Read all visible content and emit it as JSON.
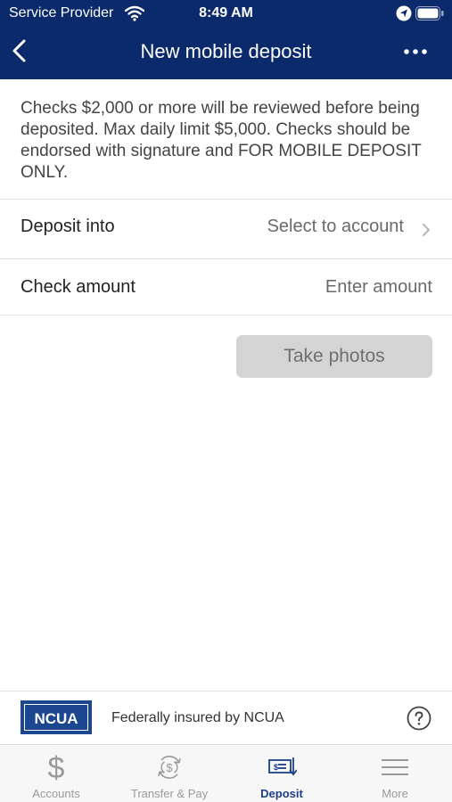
{
  "status_bar": {
    "carrier": "Service Provider",
    "time": "8:49 AM"
  },
  "nav": {
    "title": "New mobile deposit",
    "back_icon": "chevron-left-icon",
    "more_icon": "ellipsis-icon"
  },
  "notice": "Checks $2,000 or more will be reviewed before being deposited. Max daily limit $5,000. Checks should be endorsed with signature and FOR MOBILE DEPOSIT ONLY.",
  "form": {
    "deposit_into": {
      "label": "Deposit into",
      "value": "Select to account"
    },
    "check_amount": {
      "label": "Check amount",
      "placeholder": "Enter amount"
    }
  },
  "take_photos_label": "Take photos",
  "ncua": {
    "logo": "NCUA",
    "text": "Federally insured by NCUA"
  },
  "tabs": [
    {
      "label": "Accounts",
      "icon": "dollar-icon"
    },
    {
      "label": "Transfer & Pay",
      "icon": "transfer-icon"
    },
    {
      "label": "Deposit",
      "icon": "deposit-check-icon"
    },
    {
      "label": "More",
      "icon": "menu-icon"
    }
  ],
  "colors": {
    "header": "#0a2a6b",
    "active_tab": "#1c3f87",
    "button_disabled": "#d4d4d4"
  }
}
